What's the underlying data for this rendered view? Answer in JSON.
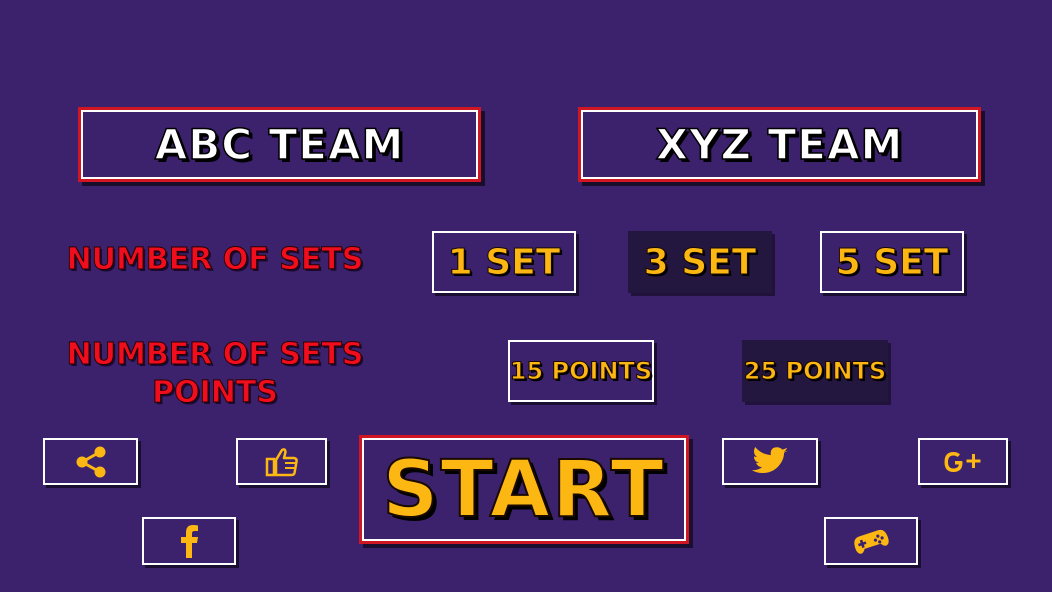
{
  "teams": {
    "left": "ABC TEAM",
    "right": "XYZ TEAM"
  },
  "sets": {
    "label": "NUMBER OF SETS",
    "options": [
      "1 SET",
      "3 SET",
      "5 SET"
    ],
    "selected": "3 SET"
  },
  "points": {
    "label_line1": "NUMBER OF SETS",
    "label_line2": "POINTS",
    "options": [
      "15 POINTS",
      "25 POINTS"
    ],
    "selected": "25 POINTS"
  },
  "start": {
    "label": "START"
  },
  "social": {
    "share": "share-icon",
    "like": "thumbs-up-icon",
    "facebook": "facebook-icon",
    "twitter": "twitter-icon",
    "google_plus": "google-plus-icon",
    "more_games": "gamepad-icon"
  },
  "colors": {
    "background": "#3c226d",
    "accent_red": "#d01622",
    "label_red": "#f00d1e",
    "gold": "#fdb713",
    "selected_bg": "#23163f"
  }
}
